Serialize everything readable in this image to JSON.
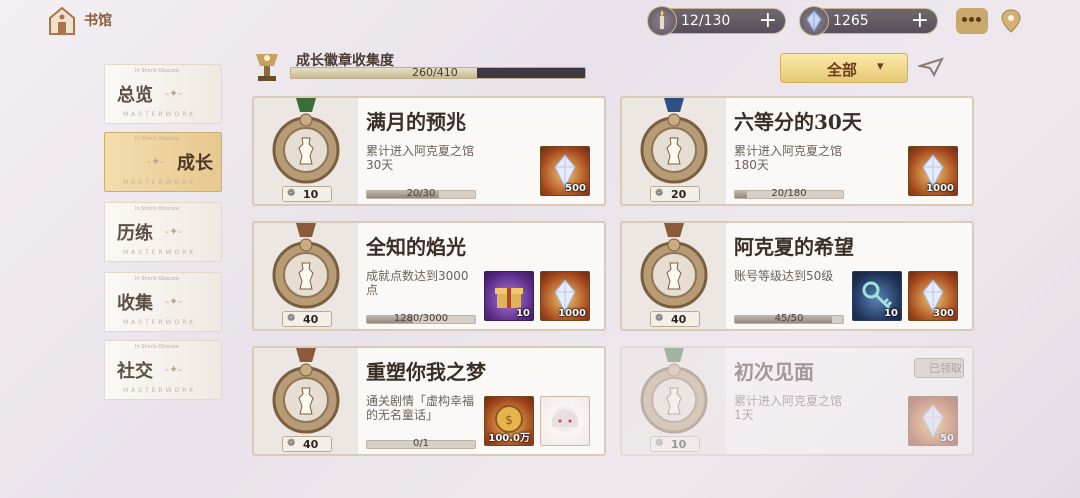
{
  "header": {
    "home_label": "书馆",
    "stamina": "12/130",
    "gems": "1265"
  },
  "progress": {
    "title": "成长徽章收集度",
    "current": 260,
    "total": 410,
    "text": "260/410",
    "fraction": 0.634
  },
  "filter": {
    "label": "全部"
  },
  "tabs": [
    {
      "label": "总览",
      "sub": "MASTERWORK",
      "tiny": "In Shoris Obscure",
      "active": false
    },
    {
      "label": "成长",
      "sub": "MASTERWORK",
      "tiny": "In Shoris Obscure",
      "active": true
    },
    {
      "label": "历练",
      "sub": "MASTERWORK",
      "tiny": "In Shoris Obscure",
      "active": false
    },
    {
      "label": "收集",
      "sub": "MASTERWORK",
      "tiny": "In Shoris Obscure",
      "active": false
    },
    {
      "label": "社交",
      "sub": "MASTERWORK",
      "tiny": "In Shoris Obscure",
      "active": false
    }
  ],
  "cards": [
    {
      "title": "满月的预兆",
      "desc": "累计进入阿克夏之馆30天",
      "level": "10",
      "progress_text": "20/30",
      "progress": 0.667,
      "medal_color": "#3c6b3a",
      "rewards": [
        {
          "type": "crystal",
          "style": "orange",
          "qty": "500"
        }
      ]
    },
    {
      "title": "六等分的30天",
      "desc": "累计进入阿克夏之馆180天",
      "level": "20",
      "progress_text": "20/180",
      "progress": 0.111,
      "medal_color": "#2e4f86",
      "rewards": [
        {
          "type": "crystal",
          "style": "orange",
          "qty": "1000"
        }
      ]
    },
    {
      "title": "全知的焰光",
      "desc": "成就点数达到3000点",
      "level": "40",
      "progress_text": "1280/3000",
      "progress": 0.427,
      "medal_color": "#8a5a3a",
      "rewards": [
        {
          "type": "gift-box",
          "style": "purple",
          "qty": "10"
        },
        {
          "type": "crystal",
          "style": "orange",
          "qty": "1000"
        }
      ]
    },
    {
      "title": "阿克夏的希望",
      "desc": "账号等级达到50级",
      "level": "40",
      "progress_text": "45/50",
      "progress": 0.9,
      "medal_color": "#8a5a3a",
      "rewards": [
        {
          "type": "key",
          "style": "blue",
          "qty": "10"
        },
        {
          "type": "crystal",
          "style": "orange",
          "qty": "300"
        }
      ]
    },
    {
      "title": "重塑你我之梦",
      "desc": "通关剧情「虚构幸福的无名童话」",
      "level": "40",
      "progress_text": "0/1",
      "progress": 0,
      "medal_color": "#8a5a3a",
      "rewards": [
        {
          "type": "coin",
          "style": "orange",
          "qty": "100.0万"
        },
        {
          "type": "portrait",
          "style": "white",
          "qty": ""
        }
      ]
    },
    {
      "title": "初次见面",
      "desc": "累计进入阿克夏之馆1天",
      "level": "10",
      "progress_text": "",
      "progress": 1,
      "medal_color": "#3c6b3a",
      "claimed": true,
      "claimed_label": "已领取",
      "rewards": [
        {
          "type": "crystal",
          "style": "orange",
          "qty": "50"
        }
      ]
    }
  ],
  "icons": {
    "home": "house-icon",
    "stamina": "candle-icon",
    "gems": "crystal-icon",
    "chat": "chat-bubble-icon",
    "location": "map-pin-icon",
    "send": "paper-plane-icon",
    "trophy": "chess-trophy-icon"
  }
}
